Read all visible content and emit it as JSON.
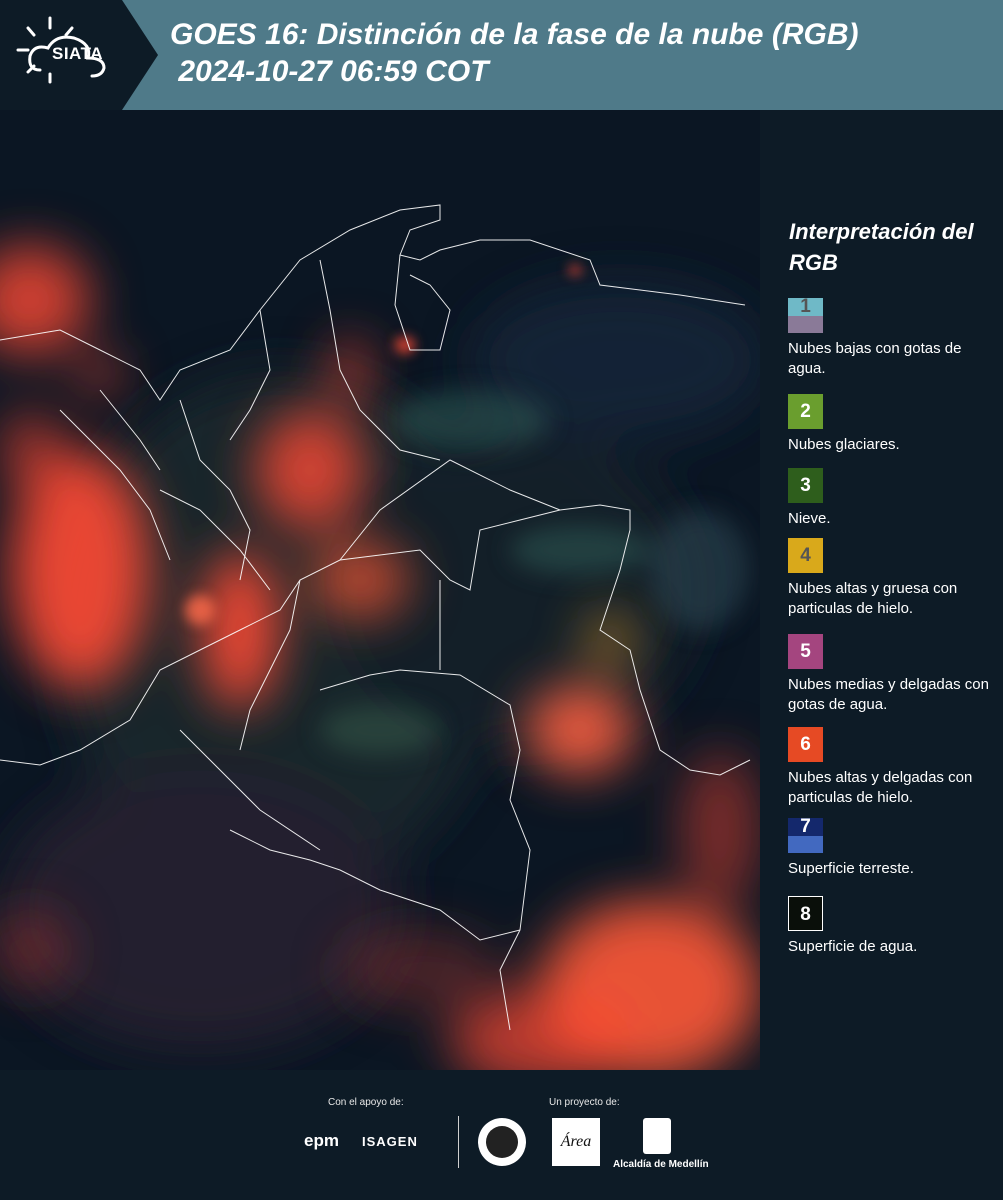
{
  "header": {
    "logo_text": "SIATA",
    "title": "GOES 16: Distinción de la fase de la nube (RGB)\n 2024-10-27 06:59 COT"
  },
  "legend": {
    "title": "Interpretación del RGB",
    "items": [
      {
        "number": "1",
        "label": "Nubes bajas con gotas de agua.",
        "color_top": "#6fb9c7",
        "color_bottom": "#8a7a98"
      },
      {
        "number": "2",
        "label": "Nubes glaciares.",
        "color": "#6a9e2e"
      },
      {
        "number": "3",
        "label": "Nieve.",
        "color": "#2e5e1c"
      },
      {
        "number": "4",
        "label": "Nubes altas y gruesa con particulas de hielo.",
        "color": "#d9a91b"
      },
      {
        "number": "5",
        "label": "Nubes medias y delgadas con gotas de agua.",
        "color": "#a4457f"
      },
      {
        "number": "6",
        "label": "Nubes altas y delgadas con particulas de hielo.",
        "color": "#e64a24"
      },
      {
        "number": "7",
        "label": "Superficie terreste.",
        "color_top": "#14286c",
        "color_bottom": "#4269c0"
      },
      {
        "number": "8",
        "label": "Superficie de agua.",
        "color": "#0a0f0a"
      }
    ]
  },
  "footer": {
    "support_label": "Con el apoyo de:",
    "support_logos": [
      "epm",
      "ISAGEN"
    ],
    "project_label": "Un proyecto de:",
    "area_logo": "Área",
    "alcaldia_label": "Alcaldía de Medellín"
  },
  "colors": {
    "header_bg": "#4f7a89",
    "panel_bg": "#0d1b26",
    "cloud_red": "#ff4a33"
  }
}
